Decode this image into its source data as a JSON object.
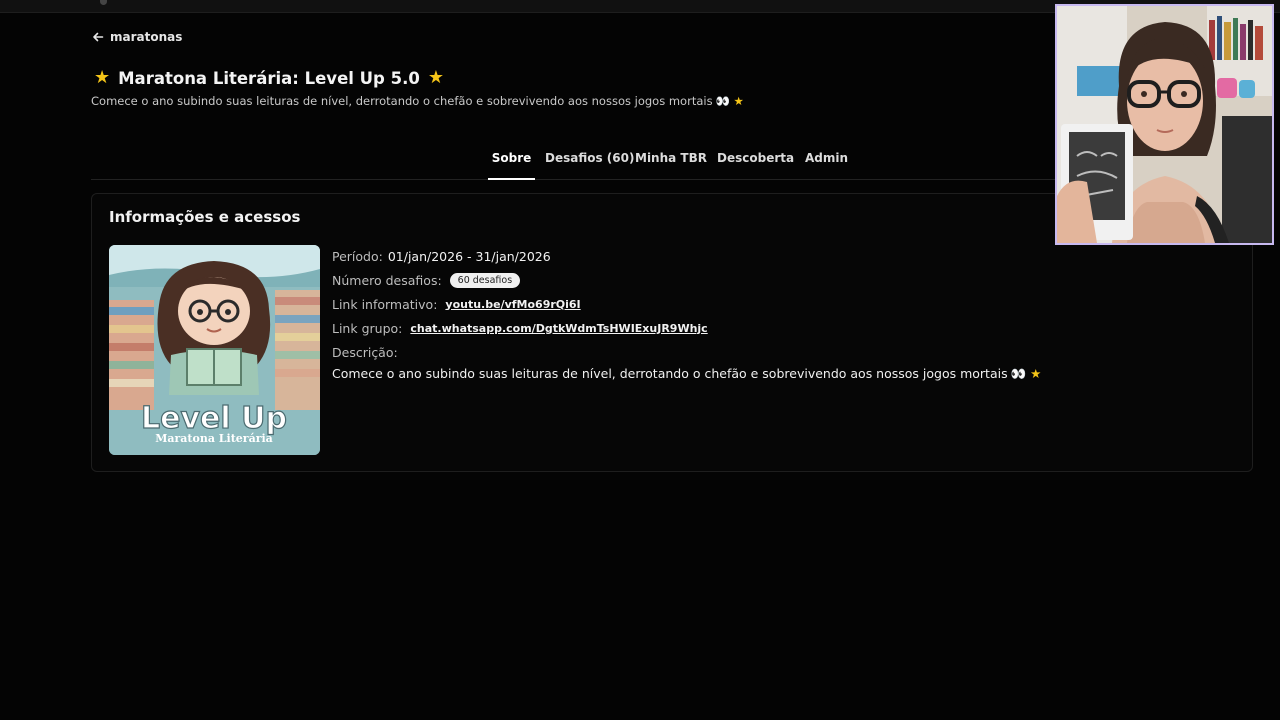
{
  "breadcrumb": {
    "back_label": "maratonas"
  },
  "header": {
    "title": "Maratona Literária: Level Up 5.0",
    "subtitle": "Comece o ano subindo suas leituras de nível, derrotando o chefão e sobrevivendo aos nossos jogos mortais",
    "subtitle_glyphs": "👀 ★"
  },
  "tabs": [
    {
      "label": "Sobre",
      "active": true
    },
    {
      "label": "Desafios (60)"
    },
    {
      "label": "Minha TBR"
    },
    {
      "label": "Descoberta"
    },
    {
      "label": "Admin"
    }
  ],
  "card": {
    "title": "Informações e acessos",
    "cover": {
      "title": "Level Up",
      "subtitle": "Maratona Literária"
    },
    "periodo_label": "Período:",
    "periodo_value": "01/jan/2026 - 31/jan/2026",
    "desafios_label": "Número desafios:",
    "desafios_badge": "60 desafios",
    "link_info_label": "Link informativo:",
    "link_info_value": "youtu.be/vfMo69rQi6I",
    "link_grupo_label": "Link grupo:",
    "link_grupo_value": "chat.whatsapp.com/DgtkWdmTsHWIExuJR9Whjc",
    "descricao_label": "Descrição:",
    "descricao_text": "Comece o ano subindo suas leituras de nível, derrotando o chefão e sobrevivendo aos nossos jogos mortais",
    "descricao_glyphs": "👀 ★"
  },
  "colors": {
    "accent_star": "#f5c518",
    "background": "#040404",
    "webcam_border": "#c7b9f0"
  },
  "icons": {
    "back": "arrow-left-icon",
    "star": "star-icon",
    "cursor": "text-cursor-icon"
  }
}
